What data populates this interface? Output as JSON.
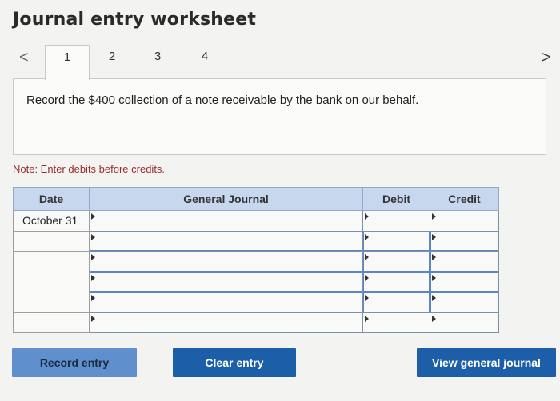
{
  "header": {
    "title": "Journal entry worksheet"
  },
  "tabs": {
    "prev_icon": "chevron-left-icon",
    "next_icon": "chevron-right-icon",
    "prev_glyph": "<",
    "next_glyph": ">",
    "items": [
      {
        "label": "1",
        "active": true
      },
      {
        "label": "2",
        "active": false
      },
      {
        "label": "3",
        "active": false
      },
      {
        "label": "4",
        "active": false
      }
    ]
  },
  "instruction": "Record the $400 collection of a note receivable by the bank on our behalf.",
  "note": "Note: Enter debits before credits.",
  "table": {
    "headers": [
      "Date",
      "General Journal",
      "Debit",
      "Credit"
    ],
    "rows": [
      {
        "date": "October 31",
        "account": "",
        "debit": "",
        "credit": ""
      },
      {
        "date": "",
        "account": "",
        "debit": "",
        "credit": ""
      },
      {
        "date": "",
        "account": "",
        "debit": "",
        "credit": ""
      },
      {
        "date": "",
        "account": "",
        "debit": "",
        "credit": ""
      },
      {
        "date": "",
        "account": "",
        "debit": "",
        "credit": ""
      },
      {
        "date": "",
        "account": "",
        "debit": "",
        "credit": ""
      }
    ]
  },
  "buttons": {
    "record": "Record entry",
    "clear": "Clear entry",
    "view": "View general journal"
  },
  "colors": {
    "header_fill": "#c7d8ee",
    "primary_button": "#1c5ea8",
    "record_button": "#5f8fcc",
    "note_text": "#9b2c2c"
  }
}
